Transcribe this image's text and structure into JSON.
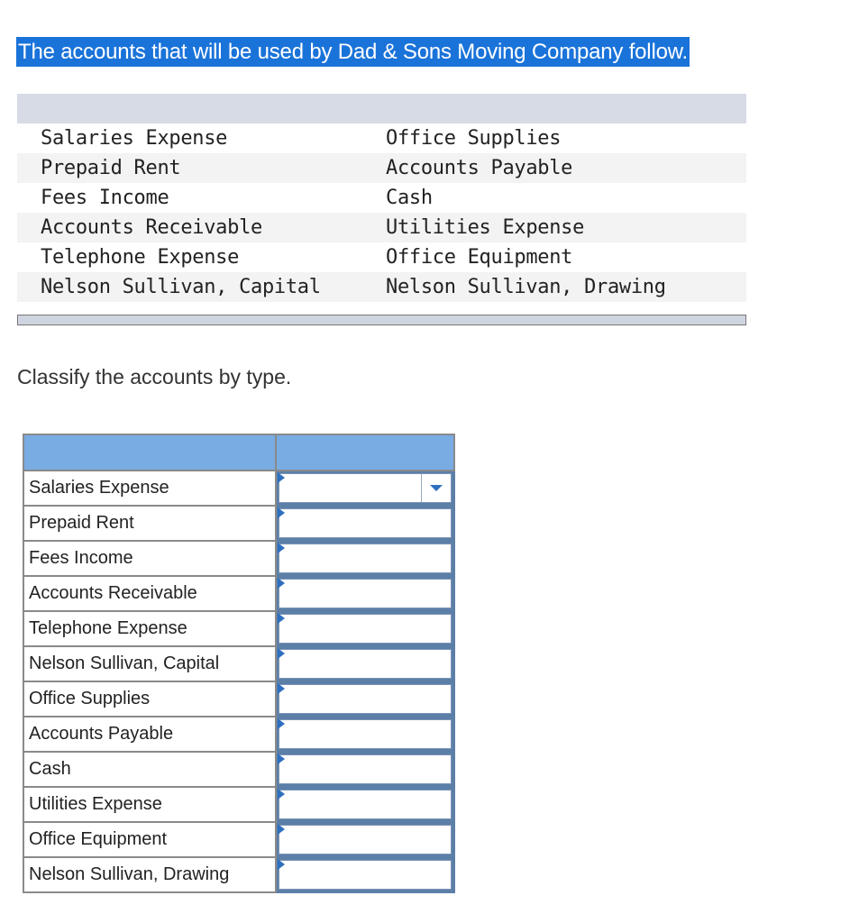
{
  "intro_text": "The accounts that will be used by Dad & Sons Moving Company follow.",
  "accounts_list": {
    "rows": [
      {
        "left": "Salaries Expense",
        "right": "Office Supplies"
      },
      {
        "left": "Prepaid Rent",
        "right": "Accounts Payable"
      },
      {
        "left": "Fees Income",
        "right": "Cash"
      },
      {
        "left": "Accounts Receivable",
        "right": "Utilities Expense"
      },
      {
        "left": "Telephone Expense",
        "right": "Office Equipment"
      },
      {
        "left": "Nelson Sullivan, Capital",
        "right": "Nelson Sullivan, Drawing"
      }
    ]
  },
  "prompt": "Classify the accounts by type.",
  "classification_table": {
    "headers": [
      "",
      ""
    ],
    "rows": [
      {
        "account": "Salaries Expense",
        "type": ""
      },
      {
        "account": "Prepaid Rent",
        "type": ""
      },
      {
        "account": "Fees Income",
        "type": ""
      },
      {
        "account": "Accounts Receivable",
        "type": ""
      },
      {
        "account": "Telephone Expense",
        "type": ""
      },
      {
        "account": "Nelson Sullivan, Capital",
        "type": ""
      },
      {
        "account": "Office Supplies",
        "type": ""
      },
      {
        "account": "Accounts Payable",
        "type": ""
      },
      {
        "account": "Cash",
        "type": ""
      },
      {
        "account": "Utilities Expense",
        "type": ""
      },
      {
        "account": "Office Equipment",
        "type": ""
      },
      {
        "account": "Nelson Sullivan, Drawing",
        "type": ""
      }
    ]
  },
  "colors": {
    "highlight": "#1a73d9",
    "header_blue": "#79ace3",
    "flag_blue": "#2f6fbf"
  }
}
